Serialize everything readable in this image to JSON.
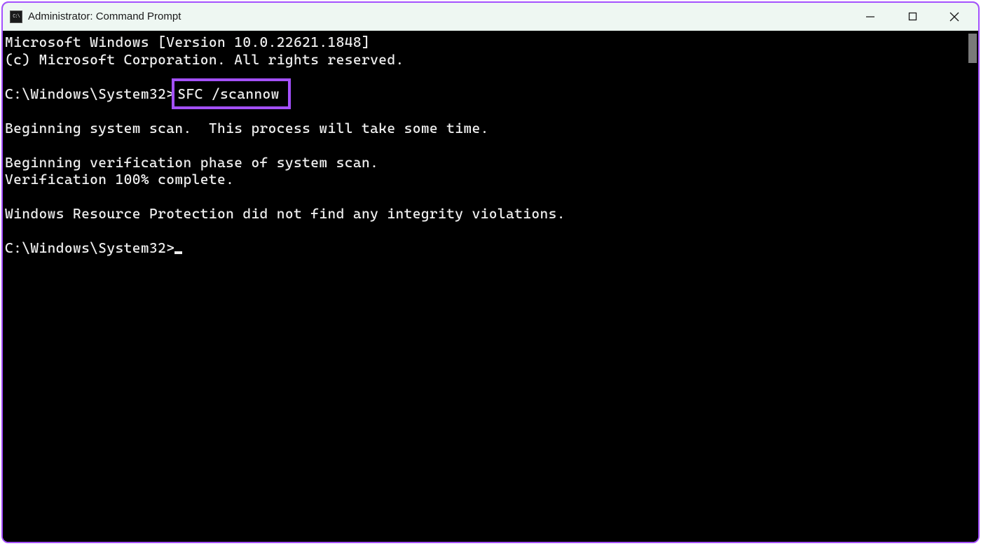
{
  "titlebar": {
    "icon_label": "C:\\",
    "title": "Administrator: Command Prompt"
  },
  "terminal": {
    "line1": "Microsoft Windows [Version 10.0.22621.1848]",
    "line2": "(c) Microsoft Corporation. All rights reserved.",
    "blank1": "",
    "prompt1_path": "C:\\Windows\\System32>",
    "prompt1_cmd": "SFC /scannow",
    "blank2": "",
    "line3": "Beginning system scan.  This process will take some time.",
    "blank3": "",
    "line4": "Beginning verification phase of system scan.",
    "line5": "Verification 100% complete.",
    "blank4": "",
    "line6": "Windows Resource Protection did not find any integrity violations.",
    "blank5": "",
    "prompt2_path": "C:\\Windows\\System32>"
  },
  "highlight": {
    "color": "#a450ff"
  }
}
